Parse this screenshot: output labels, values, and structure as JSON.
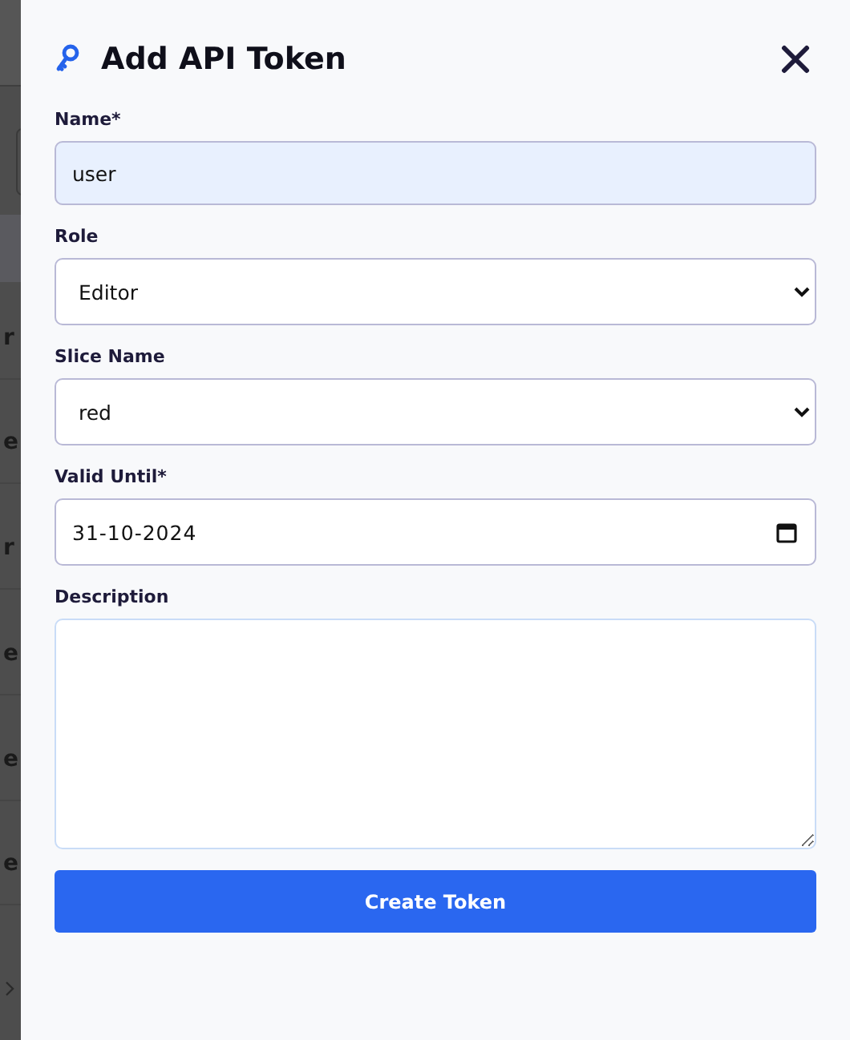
{
  "background_rows": [
    {
      "text": "r"
    },
    {
      "text": "e"
    },
    {
      "text": "r"
    },
    {
      "text": "e"
    },
    {
      "text": "e"
    },
    {
      "text": "e"
    }
  ],
  "dialog": {
    "title": "Add API Token",
    "fields": [
      {
        "kind": "text",
        "label": "Name*",
        "value": "user"
      },
      {
        "kind": "select",
        "label": "Role",
        "value": "Editor"
      },
      {
        "kind": "select",
        "label": "Slice Name",
        "value": "red"
      },
      {
        "kind": "date",
        "label": "Valid Until*",
        "value": "31-10-2024"
      },
      {
        "kind": "textarea",
        "label": "Description"
      }
    ],
    "submit": "Create Token"
  }
}
